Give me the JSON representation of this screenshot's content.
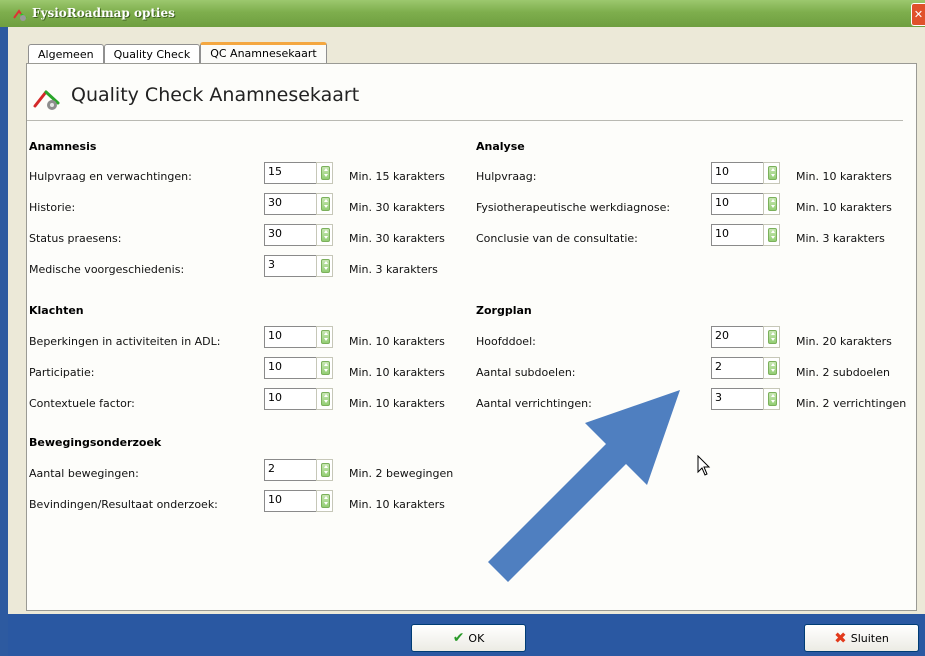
{
  "window": {
    "title": "FysioRoadmap opties"
  },
  "tabs": [
    {
      "label": "Algemeen"
    },
    {
      "label": "Quality Check"
    },
    {
      "label": "QC Anamnesekaart",
      "active": true
    }
  ],
  "page": {
    "heading": "Quality Check Anamnesekaart"
  },
  "sections": {
    "anamnesis": {
      "title": "Anamnesis",
      "rows": [
        {
          "label": "Hulpvraag en verwachtingen:",
          "value": "15",
          "hint": "Min. 15 karakters"
        },
        {
          "label": "Historie:",
          "value": "30",
          "hint": "Min. 30 karakters"
        },
        {
          "label": "Status praesens:",
          "value": "30",
          "hint": "Min. 30 karakters"
        },
        {
          "label": "Medische voorgeschiedenis:",
          "value": "3",
          "hint": "Min. 3 karakters"
        }
      ]
    },
    "klachten": {
      "title": "Klachten",
      "rows": [
        {
          "label": "Beperkingen in activiteiten in ADL:",
          "value": "10",
          "hint": "Min. 10 karakters"
        },
        {
          "label": "Participatie:",
          "value": "10",
          "hint": "Min. 10 karakters"
        },
        {
          "label": "Contextuele factor:",
          "value": "10",
          "hint": "Min. 10 karakters"
        }
      ]
    },
    "bewegingsonderzoek": {
      "title": "Bewegingsonderzoek",
      "rows": [
        {
          "label": "Aantal bewegingen:",
          "value": "2",
          "hint": "Min. 2 bewegingen"
        },
        {
          "label": "Bevindingen/Resultaat onderzoek:",
          "value": "10",
          "hint": "Min. 10 karakters"
        }
      ]
    },
    "analyse": {
      "title": "Analyse",
      "rows": [
        {
          "label": "Hulpvraag:",
          "value": "10",
          "hint": "Min. 10 karakters"
        },
        {
          "label": "Fysiotherapeutische werkdiagnose:",
          "value": "10",
          "hint": "Min. 10 karakters"
        },
        {
          "label": "Conclusie van de consultatie:",
          "value": "10",
          "hint": "Min. 3 karakters"
        }
      ]
    },
    "zorgplan": {
      "title": "Zorgplan",
      "rows": [
        {
          "label": "Hoofddoel:",
          "value": "20",
          "hint": "Min. 20 karakters"
        },
        {
          "label": "Aantal subdoelen:",
          "value": "2",
          "hint": "Min. 2 subdoelen"
        },
        {
          "label": "Aantal verrichtingen:",
          "value": "3",
          "hint": "Min. 2 verrichtingen"
        }
      ]
    }
  },
  "buttons": {
    "ok": "OK",
    "close": "Sluiten"
  },
  "colors": {
    "titlebar": "#7eae4d",
    "frame": "#2d5aa0",
    "arrow": "#4f7fc0",
    "tab_accent": "#f4a740"
  }
}
